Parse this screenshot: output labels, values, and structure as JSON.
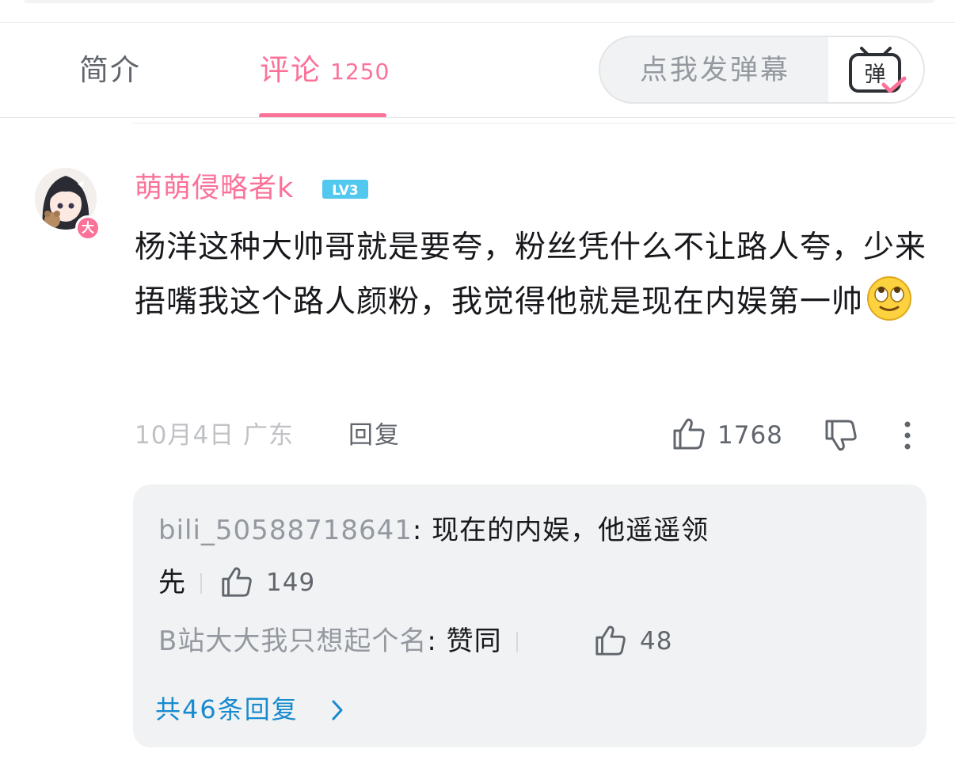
{
  "tabs": {
    "intro_label": "简介",
    "comments_label": "评论",
    "comments_count": "1250"
  },
  "danmaku": {
    "placeholder": "点我发弹幕",
    "button_icon_text": "弹"
  },
  "comment": {
    "username": "萌萌侵略者k",
    "level": "LV3",
    "avatar_badge": "大",
    "text": "杨洋这种大帅哥就是要夸，粉丝凭什么不让路人夸，少来捂嘴我这个路人颜粉，我觉得他就是现在内娱第一帅",
    "emoji": "rolling-eyes-emoji",
    "date_location": "10月4日 广东",
    "reply_label": "回复",
    "like_count": "1768"
  },
  "replies": {
    "items": [
      {
        "user": "bili_50588718641",
        "text_line1": "现在的内娱，他遥遥领",
        "text_line2": "先",
        "likes": "149"
      },
      {
        "user": "B站大大我只想起个名",
        "text": "赞同",
        "likes": "48"
      }
    ],
    "total_label": "共46条回复"
  },
  "colors": {
    "accent": "#fb7299",
    "link": "#178bcf",
    "muted": "#9499a0"
  }
}
